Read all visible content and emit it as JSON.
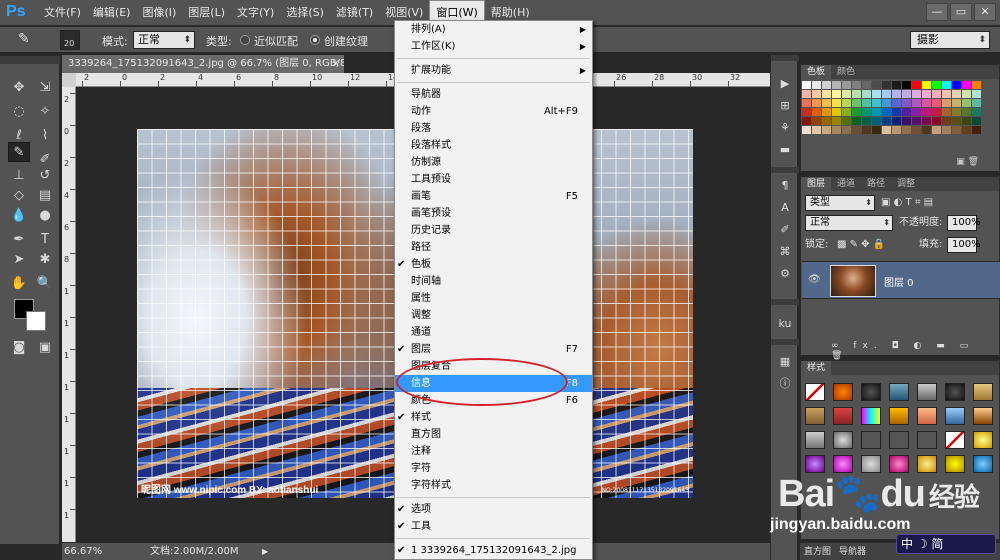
{
  "app": {
    "logo": "Ps"
  },
  "menubar": {
    "items": [
      "文件(F)",
      "编辑(E)",
      "图像(I)",
      "图层(L)",
      "文字(Y)",
      "选择(S)",
      "滤镜(T)",
      "视图(V)",
      "窗口(W)",
      "帮助(H)"
    ],
    "active_index": 8,
    "window_controls": [
      "—",
      "▭",
      "✕"
    ]
  },
  "options": {
    "brush_size": "20",
    "mode_label": "模式:",
    "mode_value": "正常",
    "type_label": "类型:",
    "radio1": "近似匹配",
    "radio2": "创建纹理",
    "workspace": "摄影"
  },
  "document": {
    "tab_title": "3339264_175132091643_2.jpg @ 66.7% (图层 0, RGB/8*) *",
    "close": "×",
    "ruler_top": [
      "2",
      "0",
      "2",
      "4",
      "6",
      "8",
      "10",
      "12",
      "14",
      "16",
      "18",
      "20",
      "22",
      "24",
      "26",
      "28",
      "30",
      "32"
    ],
    "ruler_left": [
      "2",
      "0",
      "2",
      "4",
      "6",
      "8",
      "1",
      "1",
      "1",
      "1",
      "1",
      "1",
      "1",
      "1"
    ],
    "watermark": "昵图网 www.nipic.com  BY: aotianshui",
    "watermark2": "NO:20081117135132091643"
  },
  "status": {
    "zoom": "66.67%",
    "docsize": "文档:2.00M/2.00M",
    "arrow": "▶"
  },
  "window_menu": {
    "items": [
      {
        "label": "排列(A)",
        "submenu": true
      },
      {
        "label": "工作区(K)",
        "submenu": true
      },
      {
        "sep": true
      },
      {
        "label": "扩展功能",
        "submenu": true
      },
      {
        "sep": true
      },
      {
        "label": "导航器"
      },
      {
        "label": "动作",
        "shortcut": "Alt+F9"
      },
      {
        "label": "段落"
      },
      {
        "label": "段落样式"
      },
      {
        "label": "仿制源"
      },
      {
        "label": "工具预设"
      },
      {
        "label": "画笔",
        "shortcut": "F5"
      },
      {
        "label": "画笔预设"
      },
      {
        "label": "历史记录"
      },
      {
        "label": "路径"
      },
      {
        "label": "色板",
        "checked": true
      },
      {
        "label": "时间轴"
      },
      {
        "label": "属性"
      },
      {
        "label": "调整"
      },
      {
        "label": "通道"
      },
      {
        "label": "图层",
        "checked": true,
        "shortcut": "F7"
      },
      {
        "label": "图层复合"
      },
      {
        "label": "信息",
        "shortcut": "F8",
        "highlighted": true
      },
      {
        "label": "颜色",
        "shortcut": "F6"
      },
      {
        "label": "样式",
        "checked": true
      },
      {
        "label": "直方图"
      },
      {
        "label": "注释"
      },
      {
        "label": "字符"
      },
      {
        "label": "字符样式"
      },
      {
        "sep": true
      },
      {
        "label": "选项",
        "checked": true
      },
      {
        "label": "工具",
        "checked": true
      },
      {
        "sep": true
      },
      {
        "label": "1 3339264_175132091643_2.jpg",
        "checked": true
      }
    ]
  },
  "swatches_panel": {
    "tabs": [
      "色板",
      "颜色"
    ]
  },
  "layers_panel": {
    "tabs": [
      "图层",
      "通道",
      "路径",
      "调整"
    ],
    "filter": "类型",
    "blend_mode": "正常",
    "opacity_label": "不透明度:",
    "opacity": "100%",
    "lock_label": "锁定:",
    "fill_label": "填充:",
    "fill": "100%",
    "layer_name": "图层 0",
    "footer": "∞ fx. ◘ ◐ ▬ ▭ 🗑"
  },
  "styles_panel": {
    "tabs": [
      "样式"
    ]
  },
  "bottom_tabs": [
    "直方图",
    "导航器"
  ],
  "watermark": {
    "baidu": "Bai",
    "baidu2": "du",
    "jingyan": "经验",
    "url": "jingyan.baidu.com",
    "ime": "中 ☽ 简"
  },
  "colors": {
    "highlight": "#3399ff",
    "annotation": "#d5202a",
    "layer_selected": "#52688a"
  }
}
